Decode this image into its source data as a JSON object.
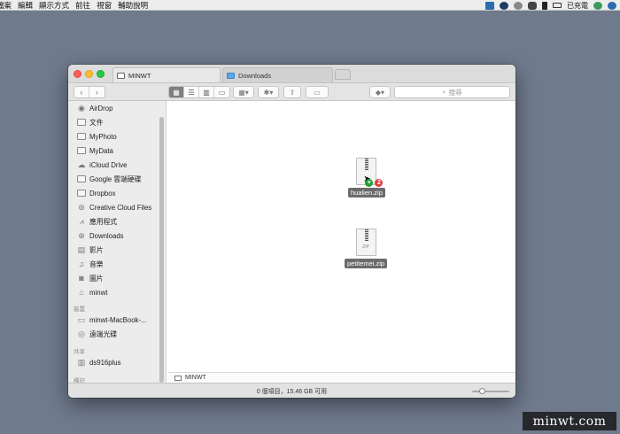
{
  "menubar": {
    "items": [
      "檔案",
      "編輯",
      "顯示方式",
      "前往",
      "視窗",
      "輔助說明"
    ],
    "battery_label": "已充電"
  },
  "window": {
    "tabs": [
      {
        "label": "MINWT"
      },
      {
        "label": "Downloads"
      }
    ],
    "search_placeholder": "搜尋",
    "sidebar": {
      "favorites": [
        {
          "label": "AirDrop",
          "icon": "airdrop-icon"
        },
        {
          "label": "文件",
          "icon": "documents-icon"
        },
        {
          "label": "MyPhoto",
          "icon": "folder-icon"
        },
        {
          "label": "MyData",
          "icon": "folder-icon"
        },
        {
          "label": "iCloud Drive",
          "icon": "cloud-icon"
        },
        {
          "label": "Google 雲端硬碟",
          "icon": "folder-icon"
        },
        {
          "label": "Dropbox",
          "icon": "folder-icon"
        },
        {
          "label": "Creative Cloud Files",
          "icon": "creative-cloud-icon"
        },
        {
          "label": "應用程式",
          "icon": "applications-icon"
        },
        {
          "label": "Downloads",
          "icon": "downloads-icon"
        },
        {
          "label": "影片",
          "icon": "movies-icon"
        },
        {
          "label": "音樂",
          "icon": "music-icon"
        },
        {
          "label": "圖片",
          "icon": "pictures-icon"
        },
        {
          "label": "minwt",
          "icon": "home-icon"
        }
      ],
      "devices_header": "裝置",
      "devices": [
        {
          "label": "minwt-MacBook-...",
          "icon": "laptop-icon"
        },
        {
          "label": "遠端光碟",
          "icon": "disc-icon"
        }
      ],
      "shared_header": "共享",
      "shared": [
        {
          "label": "ds916plus",
          "icon": "server-icon"
        }
      ],
      "tags_header": "標記"
    },
    "files": [
      {
        "name": "hualien.zip",
        "type_label": "ZIP",
        "badge_plus": "+",
        "badge_count": "2"
      },
      {
        "name": "petitemei.zip",
        "type_label": "ZIP"
      }
    ],
    "path_label": "MINWT",
    "status_text": "0 個項目，15.46 GB 可用"
  },
  "watermark": "minwt.com"
}
